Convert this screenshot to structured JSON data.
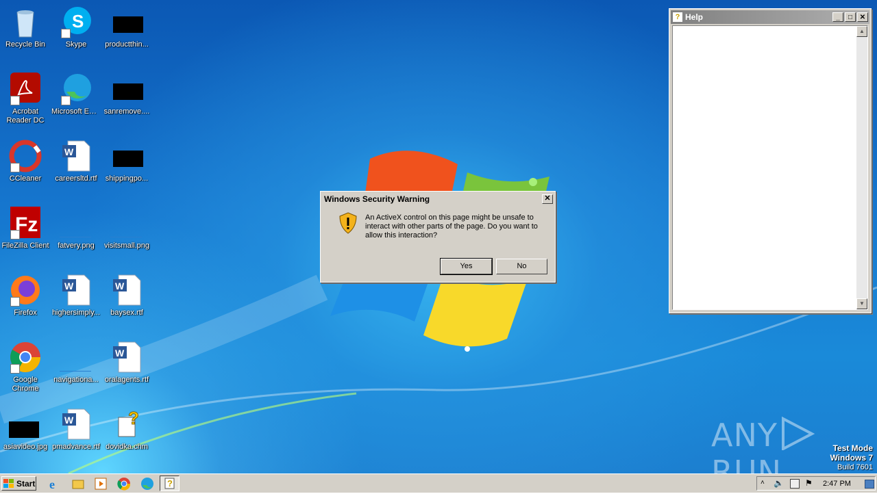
{
  "desktop_icons": [
    {
      "label": "Recycle Bin",
      "icon": "recycle-bin-icon"
    },
    {
      "label": "Skype",
      "icon": "skype-icon"
    },
    {
      "label": "productthin...",
      "icon": "redacted-file-icon"
    },
    {
      "label": "Acrobat Reader DC",
      "icon": "acrobat-icon"
    },
    {
      "label": "Microsoft Edge",
      "icon": "edge-icon"
    },
    {
      "label": "sanremove....",
      "icon": "redacted-file-icon"
    },
    {
      "label": "CCleaner",
      "icon": "ccleaner-icon"
    },
    {
      "label": "careersltd.rtf",
      "icon": "word-doc-icon"
    },
    {
      "label": "shippingpo...",
      "icon": "redacted-file-icon"
    },
    {
      "label": "FileZilla Client",
      "icon": "filezilla-icon"
    },
    {
      "label": "fatvery.png",
      "icon": "image-file-icon"
    },
    {
      "label": "visitsmall.png",
      "icon": "image-file-icon"
    },
    {
      "label": "Firefox",
      "icon": "firefox-icon"
    },
    {
      "label": "highersimply...",
      "icon": "word-doc-icon"
    },
    {
      "label": "baysex.rtf",
      "icon": "word-doc-icon"
    },
    {
      "label": "Google Chrome",
      "icon": "chrome-icon"
    },
    {
      "label": "navigationa...",
      "icon": "image-file-icon"
    },
    {
      "label": "oralagents.rtf",
      "icon": "word-doc-icon"
    },
    {
      "label": "asiavideo.jpg",
      "icon": "redacted-file-icon"
    },
    {
      "label": "pmadvance.rtf",
      "icon": "word-doc-icon"
    },
    {
      "label": "dovidka.chm",
      "icon": "chm-help-icon"
    }
  ],
  "help_window": {
    "title": "Help",
    "minimize": "_",
    "maximize": "□",
    "close": "✕"
  },
  "dialog": {
    "title": "Windows Security Warning",
    "message": "An ActiveX control on this page might be unsafe to interact with other parts of the page. Do you want to allow this interaction?",
    "yes_label": "Yes",
    "no_label": "No",
    "close": "✕"
  },
  "watermark": {
    "left": "ANY",
    "right": "RUN"
  },
  "test_mode": {
    "line1": "Test Mode",
    "line2": "Windows 7",
    "line3": "Build 7601"
  },
  "taskbar": {
    "start_label": "Start",
    "clock": "2:47 PM"
  }
}
